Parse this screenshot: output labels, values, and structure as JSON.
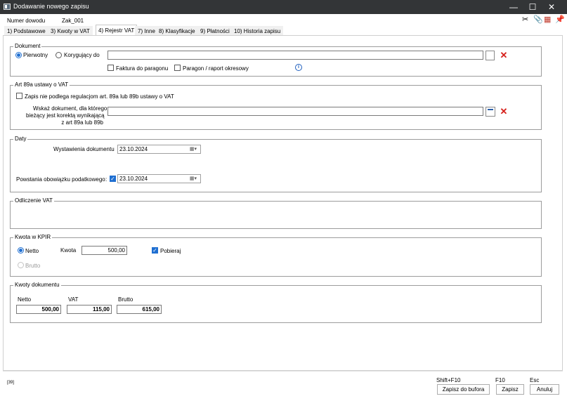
{
  "window": {
    "title": "Dodawanie nowego zapisu",
    "min": "—",
    "max": "☐",
    "close": "✕"
  },
  "header": {
    "doc_number_label": "Numer dowodu",
    "doc_number_value": "Zak_001"
  },
  "toolbar": {
    "scissors": "✂",
    "paperclip": "📎",
    "calendar": "▦",
    "pin": "📌"
  },
  "tabs": [
    {
      "label": "1) Podstawowe"
    },
    {
      "label": "3) Kwoty w VAT"
    },
    {
      "label": "4) Rejestr VAT"
    },
    {
      "label": "7) Inne"
    },
    {
      "label": "8) Klasyfikacje"
    },
    {
      "label": "9) Płatności"
    },
    {
      "label": "10) Historia zapisu"
    }
  ],
  "dokument": {
    "legend": "Dokument",
    "radio_primary": "Pierwotny",
    "radio_corrective": "Korygujący do",
    "corrects_value": "",
    "check_receipt": "Faktura do paragonu",
    "check_periodic": "Paragon / raport okresowy"
  },
  "art89": {
    "legend": "Art 89a ustawy o VAT",
    "check_label": "Zapis nie podlega regulacjom art. 89a lub 89b ustawy o VAT",
    "field_label_1": "Wskaż dokument, dla którego",
    "field_label_2": "bieżący jest korektą wynikającą",
    "field_label_3": "z art 89a lub 89b",
    "field_value": ""
  },
  "daty": {
    "legend": "Daty",
    "issue_label": "Wystawienia dokumentu",
    "issue_value": "23.10.2024",
    "tax_label": "Powstania obowiązku podatkowego",
    "tax_colon": ":",
    "tax_value": "23.10.2024"
  },
  "odliczenie": {
    "legend": "Odliczenie VAT"
  },
  "kpir": {
    "legend": "Kwota w KPIR",
    "netto": "Netto",
    "brutto": "Brutto",
    "amount_label": "Kwota",
    "amount_value": "500,00",
    "collect_label": "Pobieraj"
  },
  "kwoty": {
    "legend": "Kwoty dokumentu",
    "netto_label": "Netto",
    "vat_label": "VAT",
    "brutto_label": "Brutto",
    "netto_value": "500,00",
    "vat_value": "115,00",
    "brutto_value": "615,00"
  },
  "footer": {
    "status": "[39]",
    "shortcut_buffer": "Shift+F10",
    "shortcut_save": "F10",
    "shortcut_cancel": "Esc",
    "btn_buffer": "Zapisz do bufora",
    "btn_save": "Zapisz",
    "btn_cancel": "Anuluj"
  },
  "colors": {
    "accent": "#1f6fd1",
    "titlebar": "#333537",
    "delete": "#d6201b"
  }
}
